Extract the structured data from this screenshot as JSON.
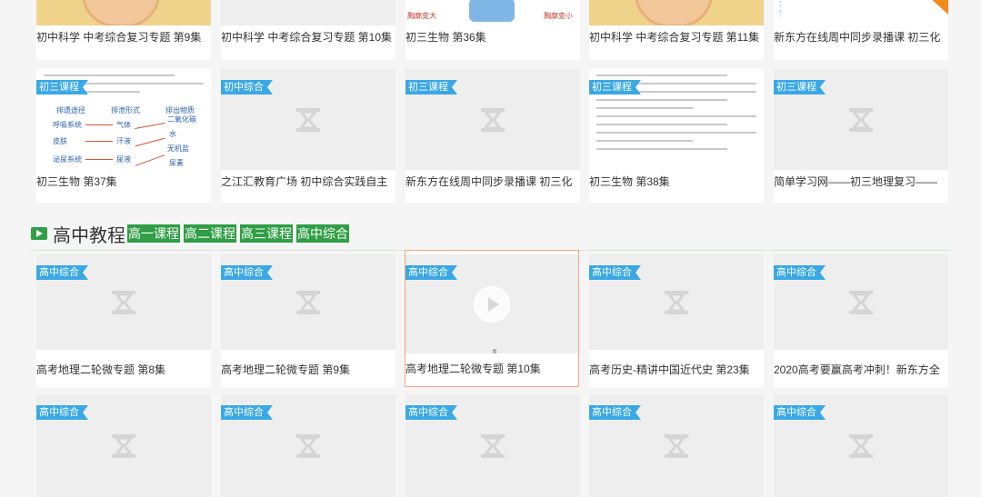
{
  "colors": {
    "tag_blue": "#3aa8e4",
    "section_green": "#2f9e44",
    "hover_border": "#f0a58a"
  },
  "section": {
    "title": "高中教程",
    "tabs": [
      "高一课程",
      "高二课程",
      "高三课程",
      "高中综合"
    ]
  },
  "row0": [
    {
      "title": "初中科学 中考综合复习专题 第9集",
      "thumb": "photo"
    },
    {
      "title": "初中科学 中考综合复习专题 第10集",
      "thumb": "blank"
    },
    {
      "title": "初三生物 第36集",
      "thumb": "doc"
    },
    {
      "title": "初中科学 中考综合复习专题 第11集",
      "thumb": "photo"
    },
    {
      "title": "新东方在线周中同步录播课 初三化",
      "thumb": "diagram"
    }
  ],
  "row1": [
    {
      "tag": "初三课程",
      "title": "初三生物 第37集",
      "thumb": "flow"
    },
    {
      "tag": "初中综合",
      "title": "之江汇教育广场 初中综合实践自主",
      "thumb": "blank"
    },
    {
      "tag": "初三课程",
      "title": "新东方在线周中同步录播课 初三化",
      "thumb": "blank"
    },
    {
      "tag": "初三课程",
      "title": "初三生物 第38集",
      "thumb": "doc"
    },
    {
      "tag": "初三课程",
      "title": "简单学习网——初三地理复习——",
      "thumb": "blank"
    }
  ],
  "row2": [
    {
      "tag": "高中综合",
      "title": "高考地理二轮微专题 第8集"
    },
    {
      "tag": "高中综合",
      "title": "高考地理二轮微专题 第9集"
    },
    {
      "tag": "高中综合",
      "title": "高考地理二轮微专题 第10集"
    },
    {
      "tag": "高中综合",
      "title": "高考历史-精讲中国近代史 第23集"
    },
    {
      "tag": "高中综合",
      "title": "2020高考要赢高考冲刺！新东方全"
    }
  ],
  "row3": [
    {
      "tag": "高中综合"
    },
    {
      "tag": "高中综合"
    },
    {
      "tag": "高中综合"
    },
    {
      "tag": "高中综合"
    },
    {
      "tag": "高中综合"
    }
  ],
  "flow_text": {
    "h1": "排遗途径",
    "h2": "排泄形式",
    "h3": "排出物质",
    "a1": "呼吸系统",
    "a2": "皮肤",
    "a3": "泌尿系统",
    "b1": "气体",
    "b2": "汗液",
    "b3": "尿液",
    "c1": "二氧化碳",
    "c2": "水",
    "c3": "无机盐",
    "c4": "尿素"
  }
}
